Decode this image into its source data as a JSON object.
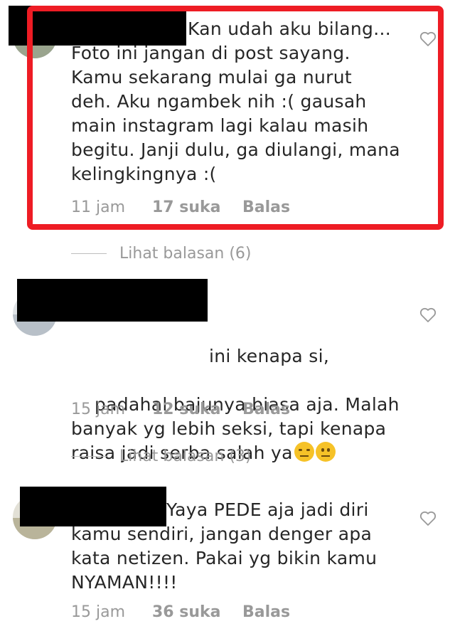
{
  "comments": [
    {
      "text": "Kan udah aku bilang...\nFoto ini jangan di post sayang.\nKamu sekarang mulai ga nurut\ndeh. Aku ngambek nih :( gausah\nmain instagram lagi kalau masih\nbegitu. Janji dulu, ga diulangi, mana\nkelingkingnya :(",
      "time": "11 jam",
      "likes": "17 suka",
      "reply": "Balas",
      "view_replies": "Lihat balasan (6)"
    },
    {
      "text_line1": "ini kenapa si,",
      "text_rest": "padahal bajunya biasa aja. Malah\nbanyak yg lebih seksi, tapi kenapa\nraisa jadi serba salah ya",
      "emojis": [
        "expressionless-face-emoji",
        "neutral-face-emoji"
      ],
      "time": "15 jam",
      "likes": "12 suka",
      "reply": "Balas",
      "view_replies": "Lihat balasan (3)"
    },
    {
      "text": "Yaya PEDE aja jadi diri\nkamu sendiri, jangan denger apa\nkata netizen. Pakai yg bikin kamu\nNYAMAN!!!!",
      "time": "15 jam",
      "likes": "36 suka",
      "reply": "Balas"
    }
  ],
  "colors": {
    "highlight_border": "#ee1c24",
    "meta_text": "#999999",
    "body_text": "#262626"
  }
}
